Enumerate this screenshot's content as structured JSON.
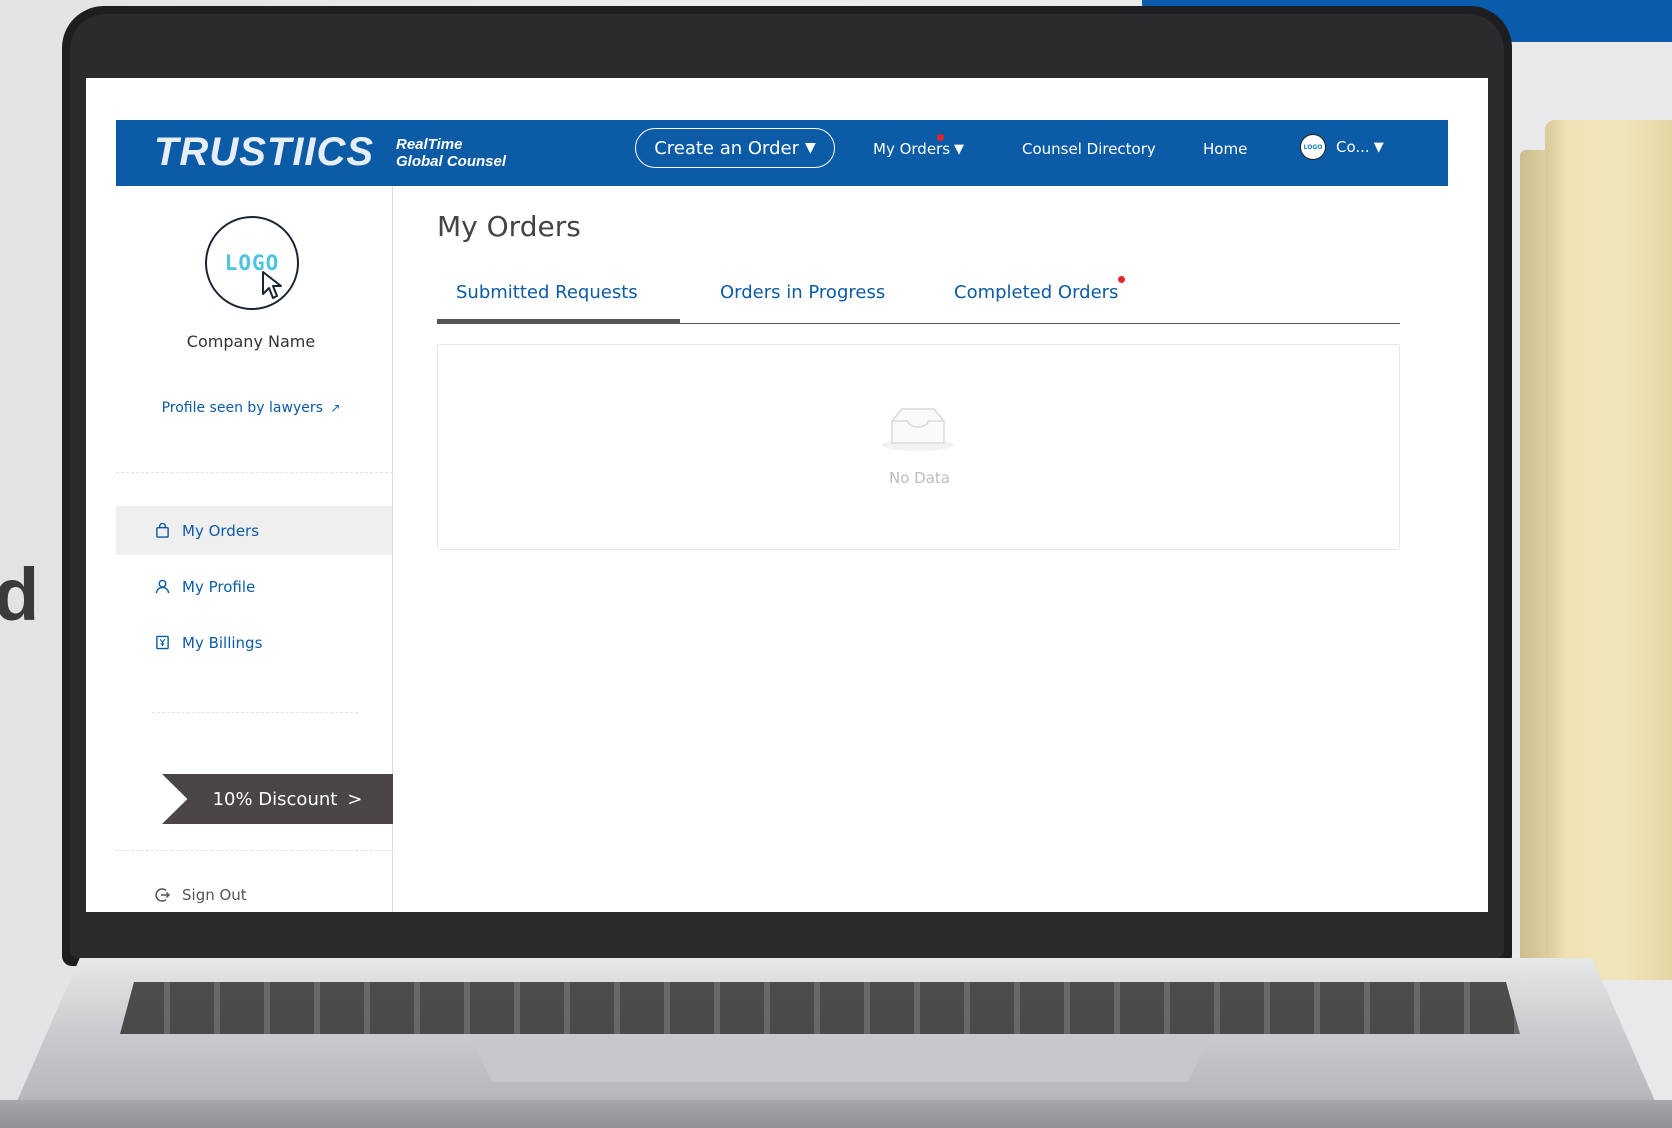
{
  "header": {
    "brand": "TRUSTIICS",
    "tagline_line1": "RealTime",
    "tagline_line2": "Global Counsel",
    "create_order": "Create an Order",
    "nav": {
      "my_orders": "My Orders",
      "counsel_directory": "Counsel Directory",
      "home": "Home",
      "account": "Co..."
    },
    "dropdown_glyph": "▼",
    "avatar_text": "LOGO"
  },
  "sidebar": {
    "logo_text": "LOGO",
    "company_name": "Company Name",
    "profile_link": "Profile seen by lawyers",
    "profile_link_icon": "↗",
    "items": [
      {
        "label": "My Orders",
        "icon": "shopping-bag-icon",
        "active": true
      },
      {
        "label": "My Profile",
        "icon": "user-icon",
        "active": false
      },
      {
        "label": "My Billings",
        "icon": "billing-icon",
        "active": false
      }
    ],
    "discount": "10% Discount",
    "discount_arrow": ">",
    "sign_out": "Sign Out"
  },
  "main": {
    "title": "My Orders",
    "tabs": [
      {
        "label": "Submitted Requests",
        "active": true
      },
      {
        "label": "Orders in Progress",
        "active": false
      },
      {
        "label": "Completed Orders",
        "active": false,
        "has_notification": true
      }
    ],
    "empty_text": "No Data"
  },
  "colors": {
    "brand_blue": "#0b5ba6",
    "notification_red": "#e3262b",
    "discount_bg": "#4a4546"
  }
}
